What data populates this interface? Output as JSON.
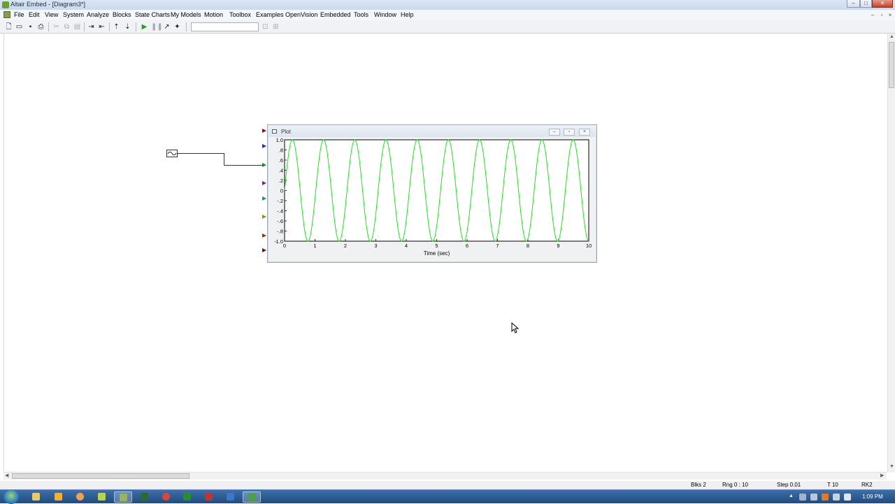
{
  "window": {
    "title": "Altair Embed - [Diagram3*]"
  },
  "menubar": {
    "items": [
      "File",
      "Edit",
      "View",
      "System",
      "Analyze",
      "Blocks",
      "State Charts",
      "My Models",
      "Motion",
      "Toolbox",
      "Examples",
      "OpenVision",
      "Embedded",
      "Tools",
      "Window",
      "Help"
    ]
  },
  "toolbar": {
    "search_value": ""
  },
  "plot_window": {
    "title": "Plot"
  },
  "chart_data": {
    "type": "line",
    "title": "",
    "xlabel": "Time (sec)",
    "ylabel": "",
    "xlim": [
      0,
      10
    ],
    "ylim": [
      -1,
      1
    ],
    "x_ticks": [
      "0",
      "1",
      "2",
      "3",
      "4",
      "5",
      "6",
      "7",
      "8",
      "9",
      "10"
    ],
    "y_ticks": [
      "1.0",
      ".8",
      ".6",
      ".4",
      ".2",
      "0",
      "-.2",
      "-.4",
      "-.6",
      "-.8",
      "-1.0"
    ],
    "grid": false,
    "series": [
      {
        "function": "sin(2*pi*f*t)",
        "frequency_hz": 0.975,
        "t_start": 0,
        "t_end": 10,
        "step": 0.01,
        "color": "#22dd22"
      }
    ]
  },
  "statusbar": {
    "blks": "Blks 2",
    "rng": "Rng 0 : 10",
    "step": "Step 0.01",
    "t": "T 10",
    "solver": "RK2"
  },
  "taskbar": {
    "clock": "1:09 PM"
  },
  "icons": [
    "start-orb",
    "explorer-icon",
    "paint-icon",
    "outlook-icon",
    "notepad-icon",
    "altair-icon",
    "sigma-icon",
    "chrome-icon",
    "excel-icon",
    "acrobat-icon",
    "outlook-alt-icon",
    "camtasia-icon"
  ],
  "colors": {
    "plot_line": "#22dd22",
    "titlebar": "#dbe6f4",
    "taskbar": "#2a5a92"
  }
}
